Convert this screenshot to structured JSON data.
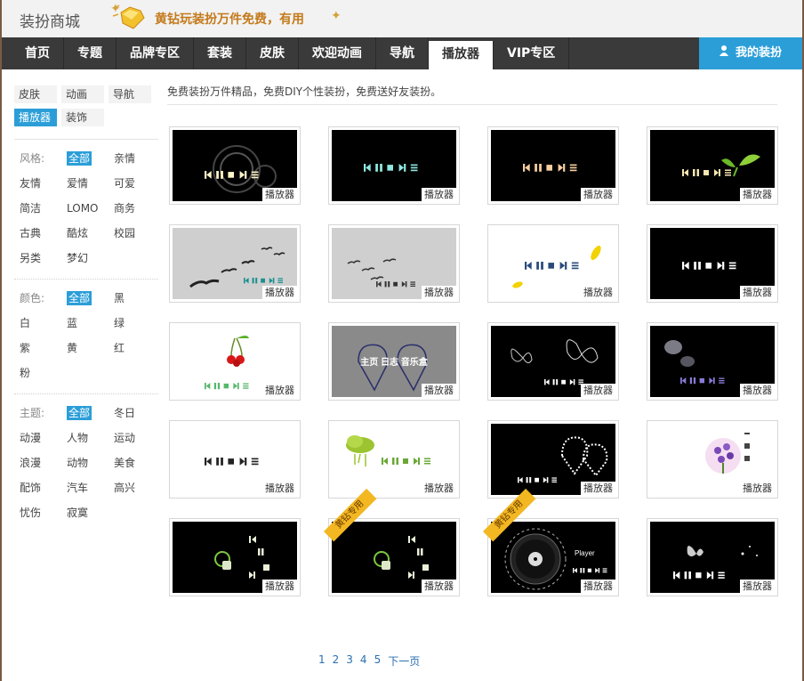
{
  "header": {
    "logo": "装扮商城",
    "promo": "黄钻玩装扮万件免费，有用"
  },
  "nav": {
    "items": [
      "首页",
      "专题",
      "品牌专区",
      "套装",
      "皮肤",
      "欢迎动画",
      "导航",
      "播放器",
      "VIP专区"
    ],
    "active_index": 7,
    "mine": "我的装扮"
  },
  "sidebar": {
    "categories": [
      "皮肤",
      "动画",
      "导航",
      "播放器",
      "装饰"
    ],
    "active_category": "播放器",
    "style": {
      "label": "风格:",
      "options": [
        "全部",
        "亲情",
        "友情",
        "爱情",
        "可爱",
        "简洁",
        "LOMO",
        "商务",
        "古典",
        "酷炫",
        "校园",
        "另类",
        "梦幻"
      ]
    },
    "color": {
      "label": "颜色:",
      "options": [
        "全部",
        "黑",
        "白",
        "蓝",
        "绿",
        "紫",
        "黄",
        "红",
        "粉"
      ]
    },
    "theme": {
      "label": "主题:",
      "options": [
        "全部",
        "冬日",
        "动漫",
        "人物",
        "运动",
        "浪漫",
        "动物",
        "美食",
        "配饰",
        "汽车",
        "高兴",
        "忧伤",
        "寂寞"
      ]
    }
  },
  "main": {
    "intro": "免费装扮万件精品，免费DIY个性装扮，免费送好友装扮。",
    "item_tag": "播放器",
    "ribbon_text": "黄钻专用",
    "items": [
      {
        "bg": "black",
        "style": "rings",
        "color": "#fff6c8"
      },
      {
        "bg": "black",
        "style": "plain",
        "color": "#8fe8e0"
      },
      {
        "bg": "black",
        "style": "plain",
        "color": "#f7cfa0"
      },
      {
        "bg": "black",
        "style": "leaf",
        "color": "#f7e6b0"
      },
      {
        "bg": "grey",
        "style": "birds",
        "color": "#1b8f8f"
      },
      {
        "bg": "grey",
        "style": "birds2",
        "color": "#333333"
      },
      {
        "bg": "white",
        "style": "petals",
        "color": "#2a4a7a"
      },
      {
        "bg": "black",
        "style": "plain",
        "color": "#ffffff"
      },
      {
        "bg": "white",
        "style": "cherry",
        "color": "#56b86a"
      },
      {
        "bg": "dgrey",
        "style": "hearts",
        "color": "#ffffff",
        "text": "主页  日志  音乐盒"
      },
      {
        "bg": "black",
        "style": "butterfly",
        "color": "#ffffff"
      },
      {
        "bg": "black",
        "style": "bubbles",
        "color": "#8a7ad8"
      },
      {
        "bg": "white",
        "style": "plain",
        "color": "#222222"
      },
      {
        "bg": "white",
        "style": "cloud",
        "color": "#6aa836"
      },
      {
        "bg": "black",
        "style": "sparkheart",
        "color": "#ffffff"
      },
      {
        "bg": "white",
        "style": "flower",
        "color": "#444444"
      },
      {
        "bg": "black",
        "style": "vertical",
        "color": "#e8f0d8",
        "ribbon": false
      },
      {
        "bg": "black",
        "style": "vertical",
        "color": "#e8f0d8",
        "ribbon": true
      },
      {
        "bg": "black",
        "style": "vinyl",
        "color": "#ffffff",
        "ribbon": true,
        "text": "Player"
      },
      {
        "bg": "black",
        "style": "butterfly2",
        "color": "#ffffff"
      }
    ]
  },
  "pager": {
    "pages": [
      "1",
      "2",
      "3",
      "4",
      "5"
    ],
    "next": "下一页"
  }
}
